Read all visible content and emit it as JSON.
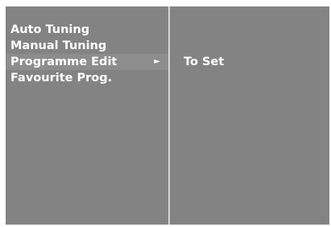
{
  "menu": {
    "items": [
      {
        "label": "Auto Tuning"
      },
      {
        "label": "Manual Tuning"
      },
      {
        "label": "Programme Edit",
        "arrow": "►"
      },
      {
        "label": "Favourite Prog."
      }
    ],
    "selected_index": 2
  },
  "submenu": {
    "items": [
      {
        "label": "To Set"
      }
    ]
  },
  "colors": {
    "screen_background": "#838383",
    "divider": "#d8d8d8",
    "text": "#ffffff"
  },
  "icons": {
    "submenu_arrow": "right-triangle-icon"
  }
}
